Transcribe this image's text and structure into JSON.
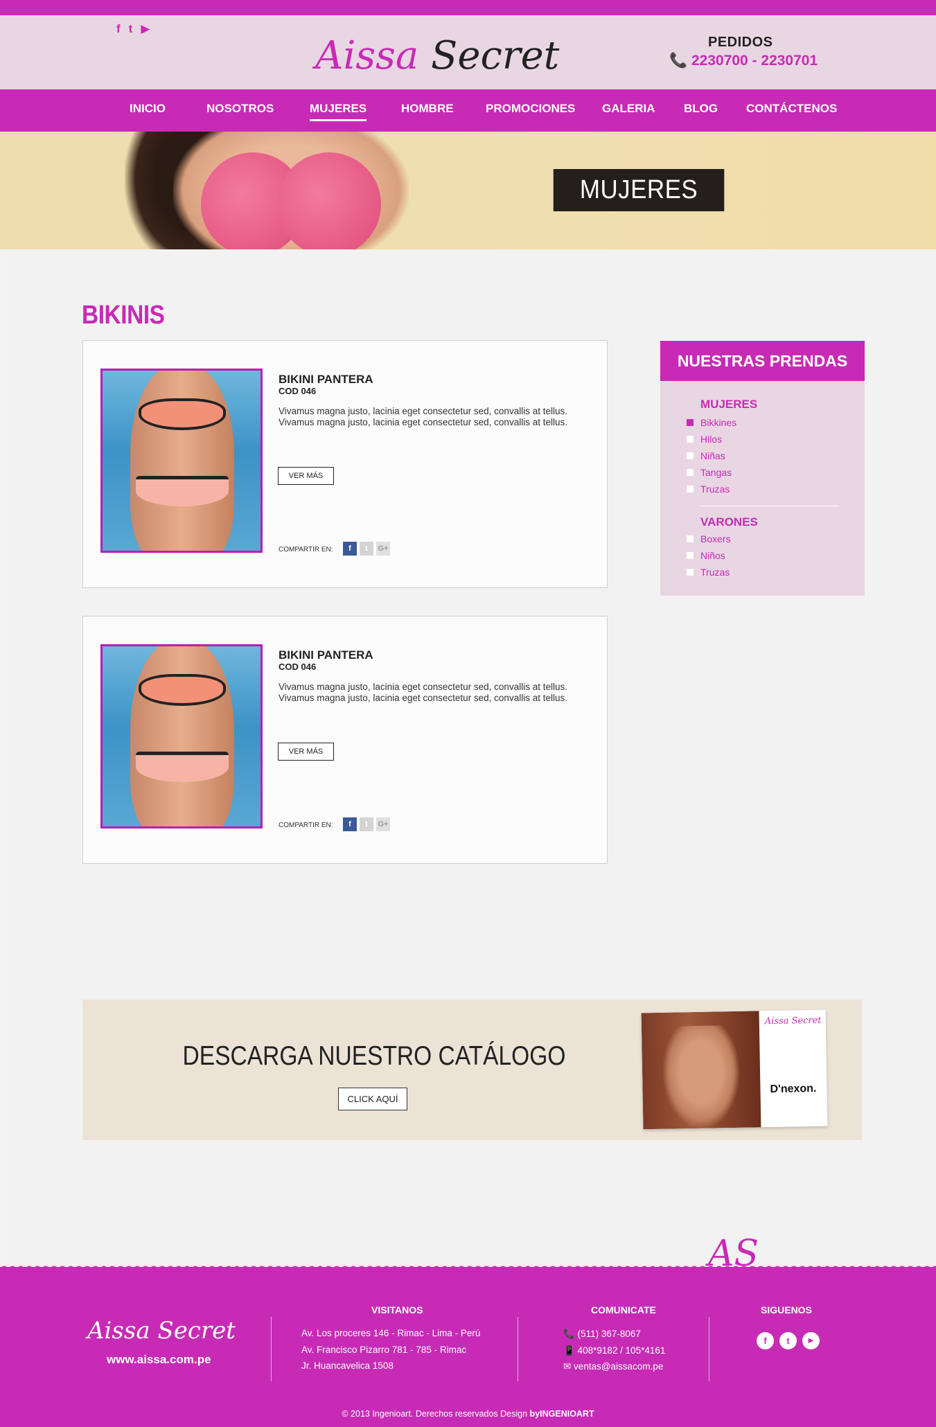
{
  "header": {
    "social": [
      {
        "icon": "facebook-icon",
        "glyph": "f"
      },
      {
        "icon": "twitter-icon",
        "glyph": "t"
      },
      {
        "icon": "youtube-icon",
        "glyph": "▶"
      }
    ],
    "logo_part1": "Aissa",
    "logo_part2": "Secret",
    "pedidos_label": "PEDIDOS",
    "phones": "📞 2230700 -  2230701"
  },
  "nav": {
    "items": [
      "INICIO",
      "NOSOTROS",
      "MUJERES",
      "HOMBRE",
      "PROMOCIONES",
      "GALERIA",
      "BLOG",
      "CONTÁCTENOS"
    ],
    "active": "MUJERES"
  },
  "banner": {
    "label": "MUJERES"
  },
  "main": {
    "title": "BIKINIS",
    "products": [
      {
        "name": "BIKINI PANTERA",
        "code": "COD 046",
        "description": "Vivamus magna justo, lacinia eget consectetur sed, convallis at tellus. Vivamus magna justo, lacinia eget consectetur sed, convallis at tellus.",
        "button": "VER MÁS",
        "share_label": "COMPARTIR EN:"
      },
      {
        "name": "BIKINI PANTERA",
        "code": "COD 046",
        "description": "Vivamus magna justo, lacinia eget consectetur sed, convallis at tellus. Vivamus magna justo, lacinia eget consectetur sed, convallis at tellus.",
        "button": "VER MÁS",
        "share_label": "COMPARTIR EN:"
      }
    ]
  },
  "sidebar": {
    "title": "NUESTRAS PRENDAS",
    "categories": [
      {
        "name": "MUJERES",
        "items": [
          {
            "label": "Bikkines",
            "selected": true
          },
          {
            "label": "Hilos",
            "selected": false
          },
          {
            "label": "Niñas",
            "selected": false
          },
          {
            "label": "Tangas",
            "selected": false
          },
          {
            "label": "Truzas",
            "selected": false
          }
        ]
      },
      {
        "name": "VARONES",
        "items": [
          {
            "label": "Boxers",
            "selected": false
          },
          {
            "label": "Niños",
            "selected": false
          },
          {
            "label": "Truzas",
            "selected": false
          }
        ]
      }
    ]
  },
  "catalog": {
    "title": "DESCARGA NUESTRO CATÁLOGO",
    "button": "CLICK AQUÍ",
    "cover_brand": "Aissa Secret",
    "cover_partner": "D'nexon."
  },
  "footer": {
    "logo": "Aissa Secret",
    "url": "www.aissa.com.pe",
    "visitanos_title": "VISITANOS",
    "addresses": [
      "Av. Los proceres 146 - Rimac - Lima - Perú",
      "Av. Francisco Pizarro 781 - 785 - Rimac",
      "Jr. Huancavelica 1508"
    ],
    "comunicate_title": "COMUNICATE",
    "contacts": [
      "📞 (511) 367-8067",
      "📱  408*9182 / 105*4161",
      "✉ ventas@aissacom.pe"
    ],
    "siguenos_title": "SIGUENOS",
    "copyright_prefix": "© 2013 Ingenioart. Derechos reservados Design ",
    "copyright_brand": "byINGENIOART"
  },
  "colors": {
    "brand": "#c72bb5",
    "header_bg": "#e9d6e3",
    "sidebar_bg": "#e9d6e3",
    "catalog_bg": "#ece3d7"
  }
}
